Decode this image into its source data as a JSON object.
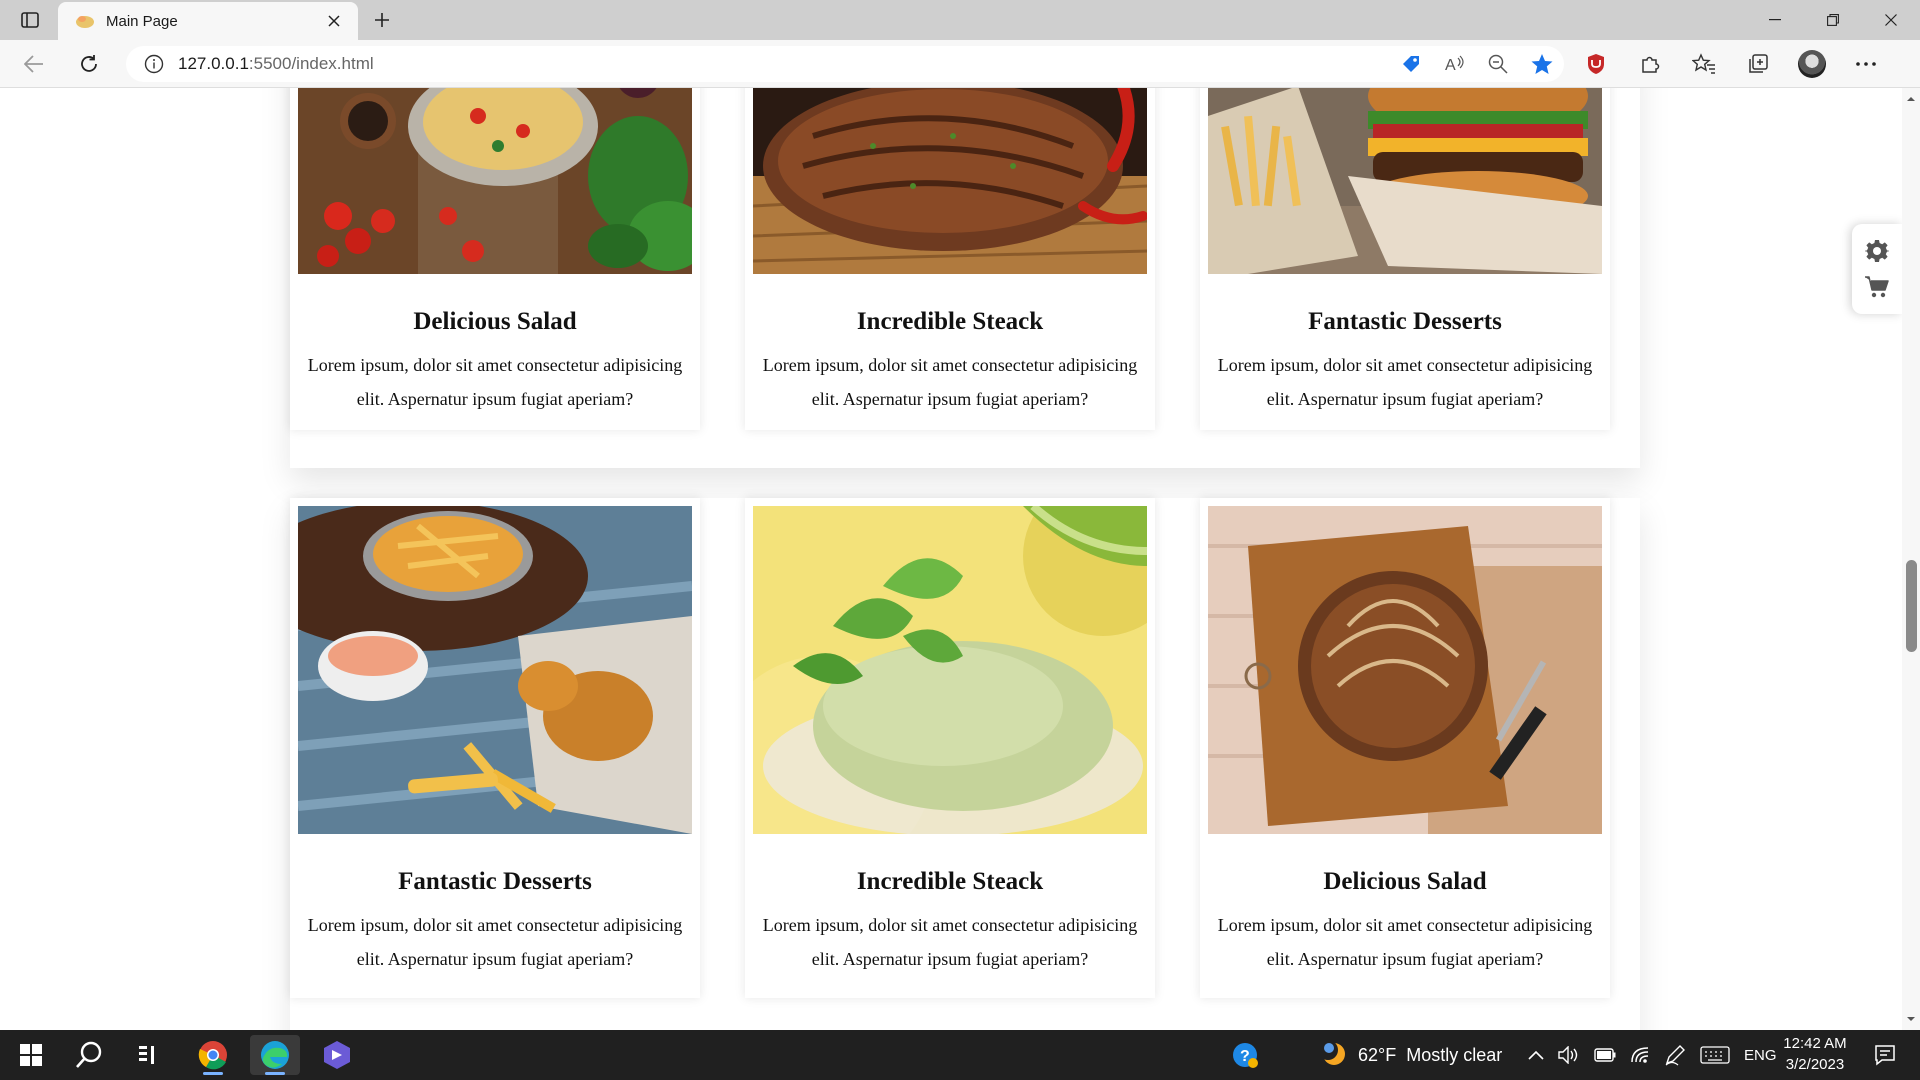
{
  "browser": {
    "tab_title": "Main Page",
    "url_host": "127.0.0.1",
    "url_rest": ":5500/index.html"
  },
  "cards": [
    {
      "title": "Delicious Salad",
      "text": "Lorem ipsum, dolor sit amet consectetur adipisicing elit. Aspernatur ipsum fugiat aperiam?",
      "image": "pasta-with-tomatoes"
    },
    {
      "title": "Incredible Steack",
      "text": "Lorem ipsum, dolor sit amet consectetur adipisicing elit. Aspernatur ipsum fugiat aperiam?",
      "image": "grilled-steak"
    },
    {
      "title": "Fantastic Desserts",
      "text": "Lorem ipsum, dolor sit amet consectetur adipisicing elit. Aspernatur ipsum fugiat aperiam?",
      "image": "burger-and-fries"
    },
    {
      "title": "Fantastic Desserts",
      "text": "Lorem ipsum, dolor sit amet consectetur adipisicing elit. Aspernatur ipsum fugiat aperiam?",
      "image": "fish-and-chips"
    },
    {
      "title": "Incredible Steack",
      "text": "Lorem ipsum, dolor sit amet consectetur adipisicing elit. Aspernatur ipsum fugiat aperiam?",
      "image": "mint-ice-cream"
    },
    {
      "title": "Delicious Salad",
      "text": "Lorem ipsum, dolor sit amet consectetur adipisicing elit. Aspernatur ipsum fugiat aperiam?",
      "image": "bread-loaf"
    }
  ],
  "side_widget": {
    "icons": [
      "gear-icon",
      "cart-icon"
    ]
  },
  "taskbar": {
    "weather_temp": "62°F",
    "weather_text": "Mostly clear",
    "language": "ENG",
    "time": "12:42 AM",
    "date": "3/2/2023"
  },
  "colors": {
    "accent": "#1a73e8",
    "taskbar": "#202020"
  }
}
